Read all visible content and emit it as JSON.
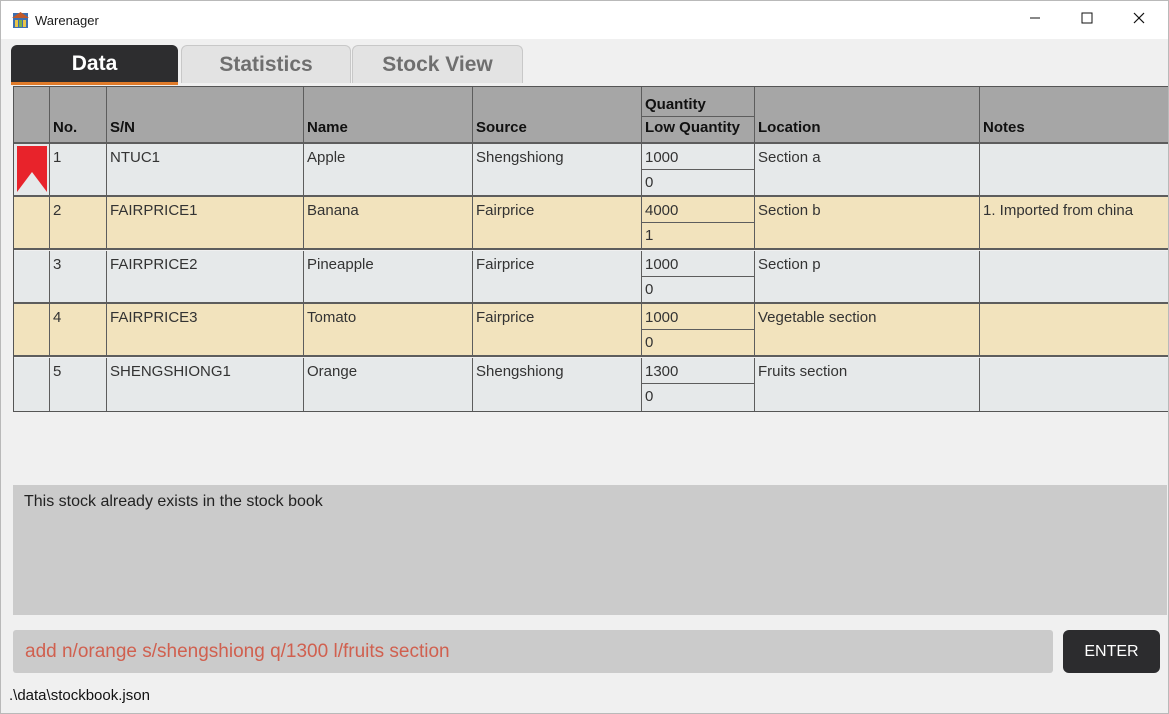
{
  "window": {
    "title": "Warenager",
    "icon": "warehouse-icon",
    "controls": [
      "minimize-icon",
      "maximize-icon",
      "close-icon"
    ]
  },
  "tabs": [
    {
      "label": "Data",
      "active": true
    },
    {
      "label": "Statistics",
      "active": false
    },
    {
      "label": "Stock View",
      "active": false
    }
  ],
  "table": {
    "headers": {
      "no": "No.",
      "sn": "S/N",
      "name": "Name",
      "source": "Source",
      "quantity": "Quantity",
      "low_quantity": "Low Quantity",
      "location": "Location",
      "notes": "Notes"
    },
    "rows": [
      {
        "no": "1",
        "sn": "NTUC1",
        "name": "Apple",
        "source": "Shengshiong",
        "quantity": "1000",
        "low_quantity": "0",
        "location": "Section a",
        "notes": "",
        "bookmarked": true,
        "highlighted": false
      },
      {
        "no": "2",
        "sn": "FAIRPRICE1",
        "name": "Banana",
        "source": "Fairprice",
        "quantity": "4000",
        "low_quantity": "1",
        "location": "Section b",
        "notes": "1. Imported from china",
        "bookmarked": false,
        "highlighted": true
      },
      {
        "no": "3",
        "sn": "FAIRPRICE2",
        "name": "Pineapple",
        "source": "Fairprice",
        "quantity": "1000",
        "low_quantity": "0",
        "location": "Section p",
        "notes": "",
        "bookmarked": false,
        "highlighted": false
      },
      {
        "no": "4",
        "sn": "FAIRPRICE3",
        "name": "Tomato",
        "source": "Fairprice",
        "quantity": "1000",
        "low_quantity": "0",
        "location": "Vegetable section",
        "notes": "",
        "bookmarked": false,
        "highlighted": true
      },
      {
        "no": "5",
        "sn": "SHENGSHIONG1",
        "name": "Orange",
        "source": "Shengshiong",
        "quantity": "1300",
        "low_quantity": "0",
        "location": "Fruits section",
        "notes": "",
        "bookmarked": false,
        "highlighted": false
      }
    ]
  },
  "result_display": {
    "text": "This stock already exists in the stock book"
  },
  "command_box": {
    "value": "add n/orange s/shengshiong q/1300 l/fruits section",
    "button_label": "ENTER"
  },
  "status_bar": {
    "path": ".\\data\\stockbook.json"
  },
  "colors": {
    "tab_active_bg": "#2d2d2f",
    "tab_active_underline": "#e07b2a",
    "header_bg": "#a6a6a6",
    "row_bg": "#e6e9ea",
    "row_highlight_bg": "#f2e3bd",
    "bookmark_red": "#e8232b",
    "command_text": "#d0604f"
  }
}
